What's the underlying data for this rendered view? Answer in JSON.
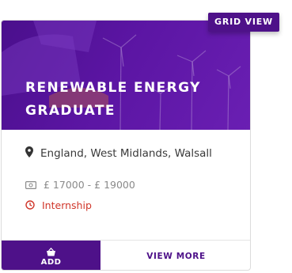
{
  "badge": {
    "label": "GRID VIEW"
  },
  "job": {
    "title_line1": "RENEWABLE ENERGY",
    "title_line2": "GRADUATE",
    "location": "England, West Midlands, Walsall",
    "salary": "£ 17000 - £ 19000",
    "type": "Internship"
  },
  "actions": {
    "add_label": "ADD",
    "view_more_label": "VIEW MORE"
  },
  "icons": {
    "location": "map-pin-icon",
    "salary": "money-icon",
    "type": "clock-icon",
    "add": "basket-icon"
  },
  "colors": {
    "brand_purple": "#4e1189",
    "type_red": "#d0362a",
    "salary_grey": "#8a8a8a",
    "text_dark": "#3a3a3a"
  }
}
